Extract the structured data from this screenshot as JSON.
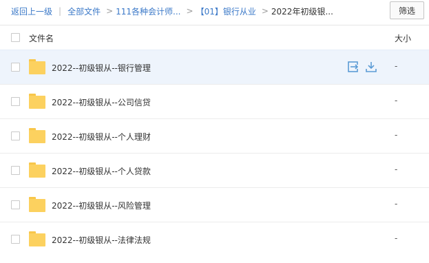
{
  "toolbar": {
    "back_label": "返回上一级",
    "all_files_label": "全部文件",
    "breadcrumb": [
      "111各种会计师...",
      "【01】银行从业",
      "2022年初级银..."
    ],
    "filter_label": "筛选"
  },
  "table": {
    "headers": {
      "name": "文件名",
      "size": "大小"
    },
    "rows": [
      {
        "name": "2022--初级银从--银行管理",
        "size": "-"
      },
      {
        "name": "2022--初级银从--公司信贷",
        "size": "-"
      },
      {
        "name": "2022--初级银从--个人理财",
        "size": "-"
      },
      {
        "name": "2022--初级银从--个人贷款",
        "size": "-"
      },
      {
        "name": "2022--初级银从--风险管理",
        "size": "-"
      },
      {
        "name": "2022--初级银从--法律法规",
        "size": "-"
      }
    ],
    "hover_actions": [
      "move-icon",
      "download-icon"
    ]
  },
  "colors": {
    "link": "#3a78c8",
    "hover_row": "#eef4fc",
    "folder": "#fcd15f",
    "icon_accent": "#5b9bd5"
  }
}
